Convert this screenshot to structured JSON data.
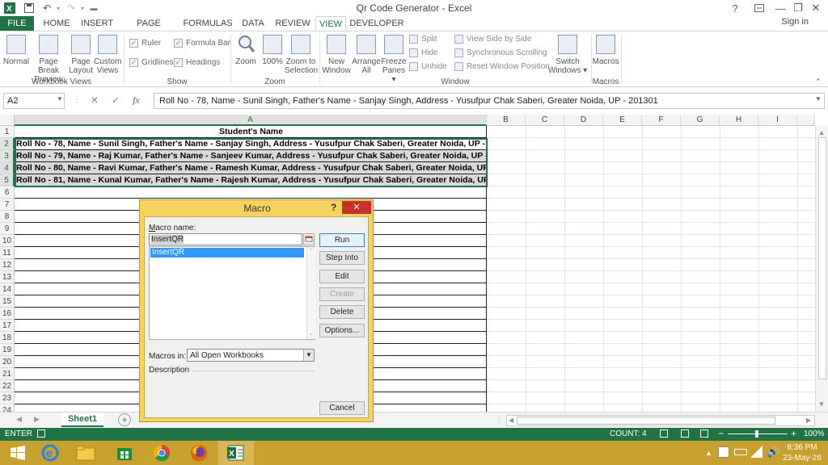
{
  "window": {
    "title": "Qr Code Generator - Excel",
    "help": "?",
    "minimize": "—",
    "restore": "❐",
    "close": "✕"
  },
  "tabs": [
    "FILE",
    "HOME",
    "INSERT",
    "PAGE LAYOUT",
    "FORMULAS",
    "DATA",
    "REVIEW",
    "VIEW",
    "DEVELOPER"
  ],
  "active_tab": "VIEW",
  "signin": "Sign in",
  "ribbon": {
    "workbook_views": {
      "label": "Workbook Views",
      "normal": "Normal",
      "page_break_1": "Page Break",
      "page_break_2": "Preview",
      "page_layout_1": "Page",
      "page_layout_2": "Layout",
      "custom_1": "Custom",
      "custom_2": "Views"
    },
    "show": {
      "label": "Show",
      "ruler": "Ruler",
      "gridlines": "Gridlines",
      "formula_bar": "Formula Bar",
      "headings": "Headings"
    },
    "zoom": {
      "label": "Zoom",
      "zoom": "Zoom",
      "hundred": "100%",
      "zoom_sel_1": "Zoom to",
      "zoom_sel_2": "Selection"
    },
    "window": {
      "label": "Window",
      "new_1": "New",
      "new_2": "Window",
      "arrange_1": "Arrange",
      "arrange_2": "All",
      "freeze_1": "Freeze",
      "freeze_2": "Panes ▾",
      "split": "Split",
      "hide": "Hide",
      "unhide": "Unhide",
      "side_by_side": "View Side by Side",
      "sync_scroll": "Synchronous Scrolling",
      "reset_pos": "Reset Window Position",
      "switch_1": "Switch",
      "switch_2": "Windows ▾"
    },
    "macros": {
      "label": "Macros",
      "macros": "Macros"
    }
  },
  "formula_bar": {
    "name_box": "A2",
    "cancel": "✕",
    "enter": "✓",
    "fx": "fx",
    "value": "Roll No - 78, Name - Sunil Singh, Father's Name - Sanjay Singh, Address - Yusufpur Chak Saberi, Greater Noida, UP - 201301"
  },
  "columns": [
    "A",
    "B",
    "C",
    "D",
    "E",
    "F",
    "G",
    "H",
    "I"
  ],
  "rows": [
    "1",
    "2",
    "3",
    "4",
    "5",
    "6",
    "7",
    "8",
    "9",
    "10",
    "11",
    "12",
    "13",
    "14",
    "15",
    "16",
    "17",
    "18",
    "19",
    "20",
    "21",
    "22",
    "23",
    "24"
  ],
  "cells": {
    "a1": "Student's Name",
    "a2": "Roll No - 78, Name - Sunil Singh, Father's Name - Sanjay Singh, Address - Yusufpur Chak Saberi, Greater Noida, UP - 201301",
    "a3": "Roll No - 79, Name - Raj Kumar, Father's Name - Sanjeev Kumar, Address - Yusufpur Chak Saberi, Greater Noida, UP - 201301",
    "a4": "Roll No - 80, Name - Ravi Kumar, Father's Name - Ramesh Kumar, Address - Yusufpur Chak Saberi, Greater Noida, UP - 201301",
    "a5": "Roll No - 81, Name - Kunal Kumar, Father's Name - Rajesh Kumar, Address - Yusufpur Chak Saberi, Greater Noida, UP - 201301"
  },
  "sheet_tab": "Sheet1",
  "add_sheet": "+",
  "status": {
    "mode": "ENTER",
    "count": "COUNT: 4",
    "zoom": "100%"
  },
  "dialog": {
    "title": "Macro",
    "help": "?",
    "close": "✕",
    "macro_name_label": "Macro name:",
    "macro_name_value": "InsertQR",
    "macro_list": [
      "InsertQR"
    ],
    "macros_in_label": "Macros in:",
    "macros_in_value": "All Open Workbooks",
    "description_label": "Description",
    "buttons": {
      "run": "Run",
      "step_into": "Step Into",
      "edit": "Edit",
      "create": "Create",
      "delete": "Delete",
      "options": "Options...",
      "cancel": "Cancel"
    }
  },
  "taskbar": {
    "time": "8:36 PM",
    "date": "23-May-26"
  }
}
